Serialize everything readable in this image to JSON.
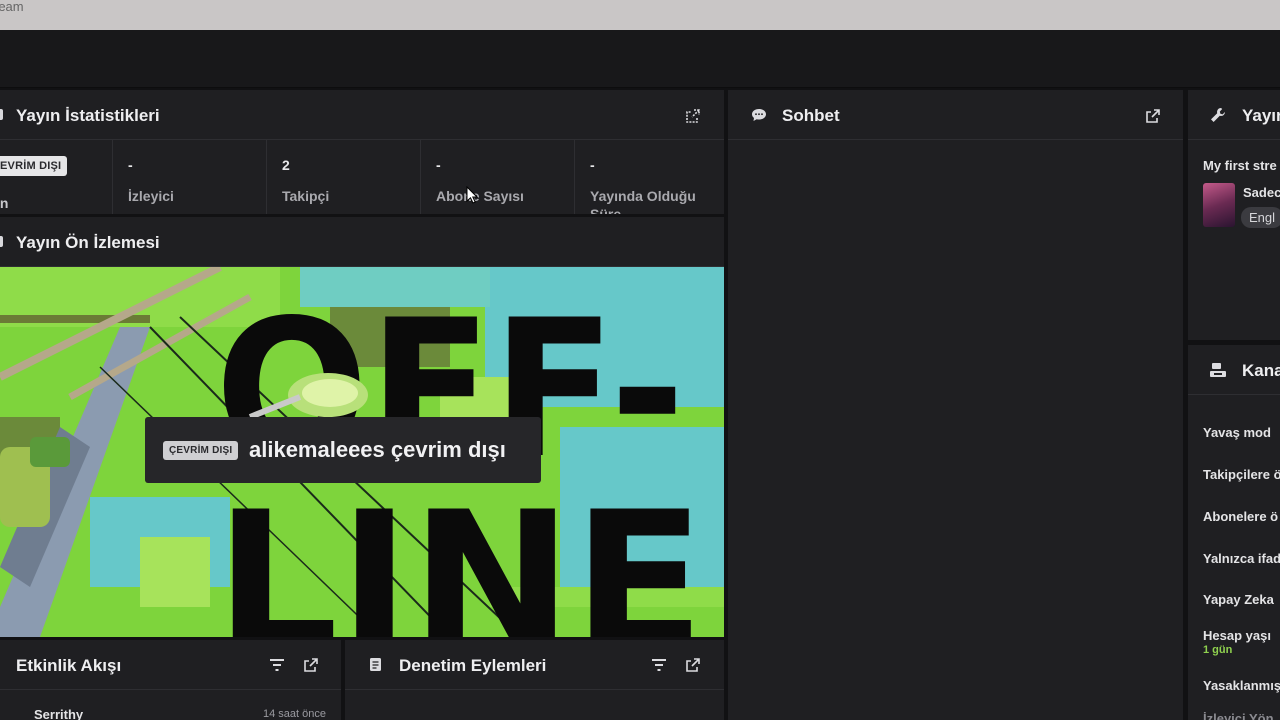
{
  "browser": {
    "tab_title": "ream"
  },
  "stats": {
    "title": "Yayın İstatistikleri",
    "status_badge": "EVRİM DIŞI",
    "status_label": "ın",
    "items": [
      {
        "value": "-",
        "label": "İzleyici"
      },
      {
        "value": "2",
        "label": "Takipçi"
      },
      {
        "value": "-",
        "label": "Abone Sayısı"
      },
      {
        "value": "-",
        "label": "Yayında Olduğu Süre"
      }
    ]
  },
  "preview": {
    "title": "Yayın Ön İzlemesi",
    "offline_word_1": "OFF-",
    "offline_word_2": "LINE",
    "card_badge": "ÇEVRİM DIŞI",
    "card_message": "alikemaleees çevrim dışı"
  },
  "activity": {
    "title": "Etkinlik Akışı",
    "first_item": {
      "user": "Serrithy",
      "time": "14 saat önce"
    }
  },
  "moderation": {
    "title": "Denetim Eylemleri"
  },
  "chat": {
    "title": "Sohbet"
  },
  "quick_info": {
    "title": "Yayın",
    "stream_title": "My first stre",
    "category": "Sadec",
    "tag": "Engl"
  },
  "channel_settings": {
    "title": "Kana",
    "rows": [
      "Yavaş mod",
      "Takipçilere ö",
      "Abonelere ö",
      "Yalnızca ifad",
      "Yapay Zeka"
    ],
    "account_age_label": "Hesap yaşı",
    "account_age_value": "1 gün",
    "banned_label": "Yasaklanmış",
    "viewer_label": "İzleyici Yön"
  },
  "colors": {
    "accent_green": "#8fd14f",
    "panel": "#1f1f22",
    "background": "#111113"
  },
  "icons": [
    "popout-icon",
    "chat-icon",
    "wrench-icon",
    "channel-settings-icon",
    "filter-icon",
    "moderation-log-icon",
    "mouse-cursor-icon"
  ]
}
